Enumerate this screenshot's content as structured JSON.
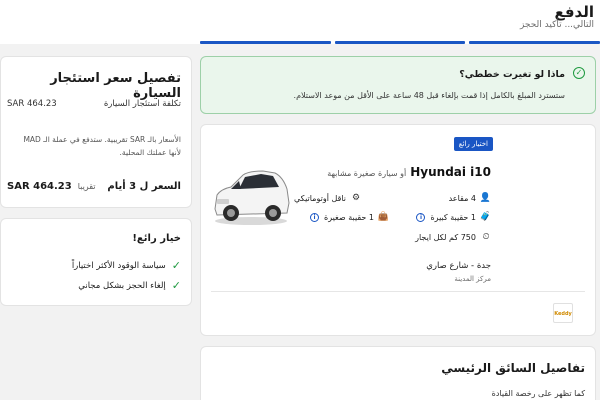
{
  "header": {
    "title": "الدفع",
    "subtitle": "التالي... تأكيد الحجز"
  },
  "notice": {
    "title": "ماذا لو تغيرت خططي؟",
    "text": "ستسترد المبلغ بالكامل إذا قمت بإلغاء قبل 48 ساعة على الأقل من موعد الاستلام."
  },
  "car": {
    "badge": "اختيار رائع",
    "model": "Hyundai i10",
    "similar": "أو سيارة صغيرة مشابهة",
    "specs": {
      "seats": "4 مقاعد",
      "transmission": "ناقل أوتوماتيكي",
      "large_bag": "1 حقيبة كبيرة",
      "small_bag": "1 حقيبة صغيرة",
      "mileage": "750 كم لكل ايجار"
    },
    "location": "جدة - شارع صاري",
    "location_sub": "مركز المدينة",
    "supplier_logo_text": "Keddy"
  },
  "price": {
    "title": "تفصيل سعر استئجار السيارة",
    "rental_label": "تكلفة استئجار السيارة",
    "rental_amount": "SAR 464.23",
    "note": "الأسعار بالـ SAR تقريبية. ستدفع في عملة الـ MAD لأنها عملتك المحلية.",
    "total_label": "السعر ل 3 أيام",
    "total_approx": "تقريبا",
    "total_amount": "SAR 464.23"
  },
  "great_choice": {
    "title": "خيار رائع!",
    "items": [
      "سياسة الوقود الأكثر اختياراً",
      "إلغاء الحجز بشكل مجاني"
    ]
  },
  "driver": {
    "title": "تفاصيل السائق الرئيسي",
    "subtitle": "كما تظهر على رخصة القيادة"
  },
  "colors": {
    "primary": "#1a56c4",
    "success": "#1f9a40",
    "success_bg": "#eaf6ec"
  }
}
